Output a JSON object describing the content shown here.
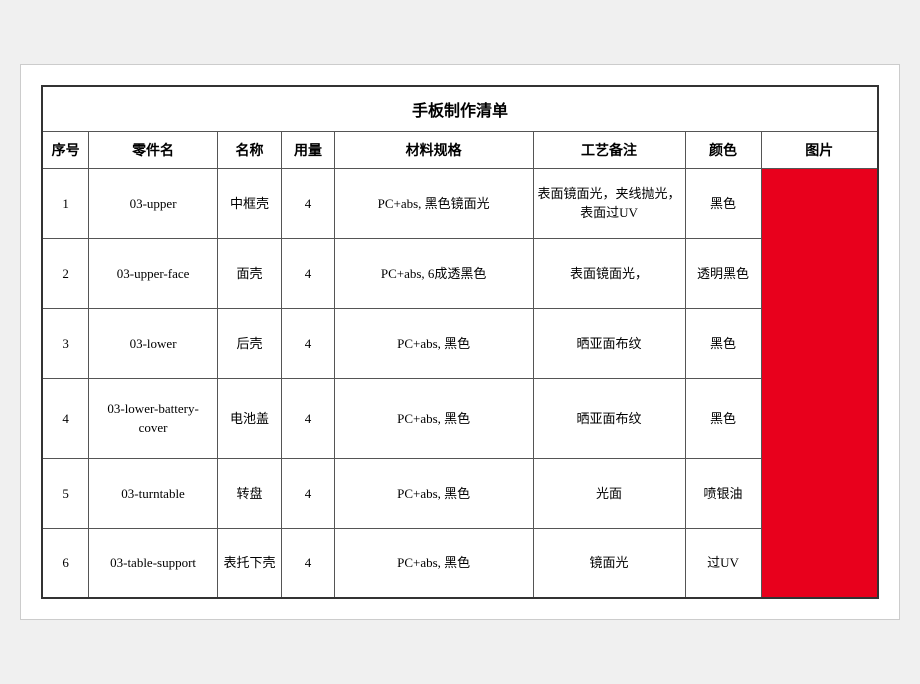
{
  "title": "手板制作清单",
  "headers": {
    "seq": "序号",
    "part_code": "零件名",
    "part_name": "名称",
    "qty": "用量",
    "spec": "材料规格",
    "process": "工艺备注",
    "color": "颜色",
    "image": "图片"
  },
  "rows": [
    {
      "seq": "1",
      "part_code": "03-upper",
      "part_name": "中框壳",
      "qty": "4",
      "spec": "PC+abs, 黑色镜面光",
      "process": "表面镜面光，夹线抛光，表面过UV",
      "color": "黑色"
    },
    {
      "seq": "2",
      "part_code": "03-upper-face",
      "part_name": "面壳",
      "qty": "4",
      "spec": "PC+abs, 6成透黑色",
      "process": "表面镜面光，",
      "color": "透明黑色"
    },
    {
      "seq": "3",
      "part_code": "03-lower",
      "part_name": "后壳",
      "qty": "4",
      "spec": "PC+abs, 黑色",
      "process": "晒亚面布纹",
      "color": "黑色"
    },
    {
      "seq": "4",
      "part_code": "03-lower-battery-cover",
      "part_name": "电池盖",
      "qty": "4",
      "spec": "PC+abs, 黑色",
      "process": "晒亚面布纹",
      "color": "黑色"
    },
    {
      "seq": "5",
      "part_code": "03-turntable",
      "part_name": "转盘",
      "qty": "4",
      "spec": "PC+abs, 黑色",
      "process": "光面",
      "color": "喷银油"
    },
    {
      "seq": "6",
      "part_code": "03-table-support",
      "part_name": "表托下壳",
      "qty": "4",
      "spec": "PC+abs, 黑色",
      "process": "镜面光",
      "color": "过UV"
    }
  ]
}
